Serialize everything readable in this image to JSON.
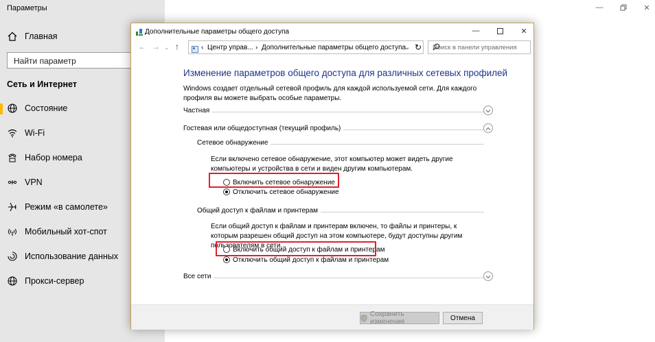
{
  "settings": {
    "title": "Параметры",
    "home_label": "Главная",
    "search_placeholder": "Найти параметр",
    "section": "Сеть и Интернет",
    "items": [
      {
        "label": "Состояние",
        "icon": "globe-status-icon"
      },
      {
        "label": "Wi-Fi",
        "icon": "wifi-icon"
      },
      {
        "label": "Набор номера",
        "icon": "dialup-icon"
      },
      {
        "label": "VPN",
        "icon": "vpn-icon"
      },
      {
        "label": "Режим «в самолете»",
        "icon": "airplane-icon"
      },
      {
        "label": "Мобильный хот-спот",
        "icon": "hotspot-icon"
      },
      {
        "label": "Использование данных",
        "icon": "data-usage-icon"
      },
      {
        "label": "Прокси-сервер",
        "icon": "globe-icon"
      }
    ],
    "active_index": 0,
    "accent": "#ffb900"
  },
  "dialog": {
    "title": "Дополнительные параметры общего доступа",
    "breadcrumb": [
      "Центр управ...",
      "Дополнительные параметры общего доступа"
    ],
    "search_placeholder": "Поиск в панели управления",
    "heading": "Изменение параметров общего доступа для различных сетевых профилей",
    "description": "Windows создает отдельный сетевой профиль для каждой используемой сети. Для каждого профиля вы можете выбрать особые параметры.",
    "profiles": {
      "private": "Частная",
      "guest": "Гостевая или общедоступная (текущий профиль)",
      "all": "Все сети"
    },
    "discovery": {
      "heading": "Сетевое обнаружение",
      "text": "Если включено сетевое обнаружение, этот компьютер может видеть другие компьютеры и устройства в сети и виден другим компьютерам.",
      "on_label": "Включить сетевое обнаружение",
      "off_label": "Отключить сетевое обнаружение",
      "selected": "off"
    },
    "sharing": {
      "heading": "Общий доступ к файлам и принтерам",
      "text": "Если общий доступ к файлам и принтерам включен, то файлы и принтеры, к которым разрешен общий доступ на этом компьютере, будут доступны другим пользователям в сети.",
      "on_label": "Включить общий доступ к файлам и принтерам",
      "off_label": "Отключить общий доступ к файлам и принтерам",
      "selected": "off"
    },
    "save_label": "Сохранить изменения",
    "cancel_label": "Отмена",
    "heading_color": "#1e3287",
    "highlight_color": "#e0202e"
  }
}
